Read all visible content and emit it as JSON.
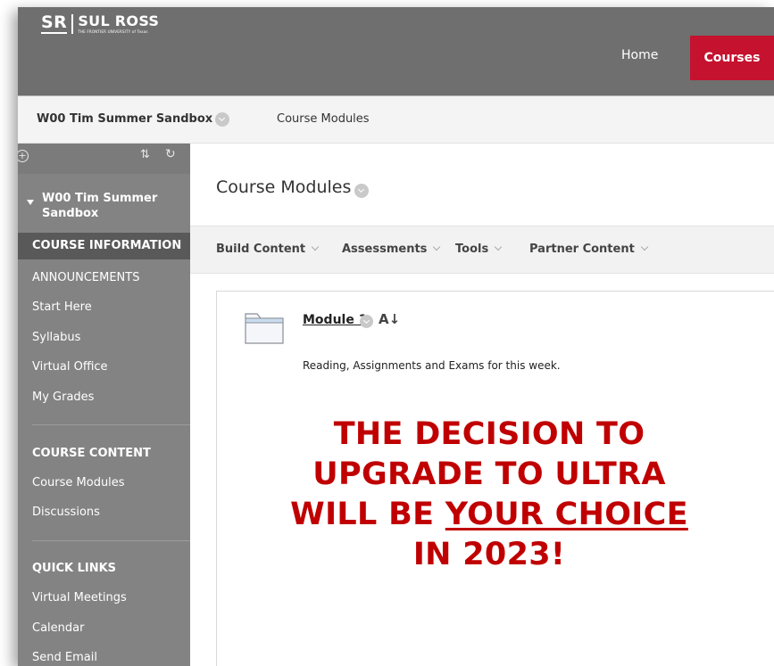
{
  "header": {
    "logo_mark": "SR",
    "logo_name": "SUL ROSS",
    "logo_tagline": "THE FRONTIER UNIVERSITY of Texas",
    "nav": [
      {
        "label": "Home",
        "active": false
      },
      {
        "label": "Courses",
        "active": true
      }
    ],
    "accent_color": "#c4122f"
  },
  "breadcrumb": {
    "course": "W00 Tim Summer Sandbox",
    "page": "Course Modules"
  },
  "sidebar": {
    "course_title": "W00 Tim Summer Sandbox",
    "sections": [
      {
        "heading": "COURSE INFORMATION",
        "items": [
          "ANNOUNCEMENTS",
          "Start Here",
          "Syllabus",
          "Virtual Office",
          "My Grades"
        ]
      },
      {
        "heading": "COURSE CONTENT",
        "items": [
          "Course Modules",
          "Discussions"
        ]
      },
      {
        "heading": "QUICK LINKS",
        "items": [
          "Virtual Meetings",
          "Calendar",
          "Send Email"
        ]
      }
    ],
    "icons": [
      "add-icon",
      "sort-icon",
      "refresh-icon"
    ]
  },
  "main": {
    "page_title": "Course Modules",
    "action_menus": [
      "Build Content",
      "Assessments",
      "Tools",
      "Partner Content"
    ],
    "module": {
      "title": "Module 1",
      "description": "Reading, Assignments and Exams for this week.",
      "icon": "folder-icon"
    },
    "announcement": {
      "line1": "THE DECISION TO",
      "line2": "UPGRADE TO ULTRA",
      "line3_prefix": "WILL BE ",
      "line3_emphasis": "YOUR CHOICE",
      "line4": "IN 2023!",
      "color": "#c00000"
    }
  }
}
